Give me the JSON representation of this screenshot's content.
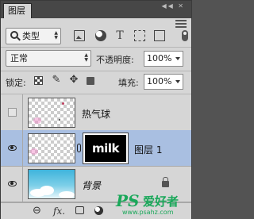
{
  "panel": {
    "tab_label": "图层",
    "window_controls": "◀◀ ✕"
  },
  "filter": {
    "type_label": "类型",
    "icons": [
      "pixel-filter-icon",
      "adjustment-filter-icon",
      "type-filter-icon",
      "shape-filter-icon",
      "smart-object-filter-icon"
    ]
  },
  "blend": {
    "mode": "正常",
    "opacity_label": "不透明度:",
    "opacity_value": "100%"
  },
  "lock": {
    "label": "锁定:",
    "fill_label": "填充:",
    "fill_value": "100%"
  },
  "layers": [
    {
      "name": "热气球",
      "visible": false,
      "selected": false
    },
    {
      "name": "图层 1",
      "visible": true,
      "selected": true,
      "mask_text": "milk"
    },
    {
      "name": "背景",
      "visible": true,
      "selected": false,
      "locked": true
    }
  ],
  "bottom_bar": {
    "fx_label": "fx."
  },
  "watermark": {
    "brand": "PS",
    "text": "爱好者",
    "url": "www.psahz.com"
  }
}
